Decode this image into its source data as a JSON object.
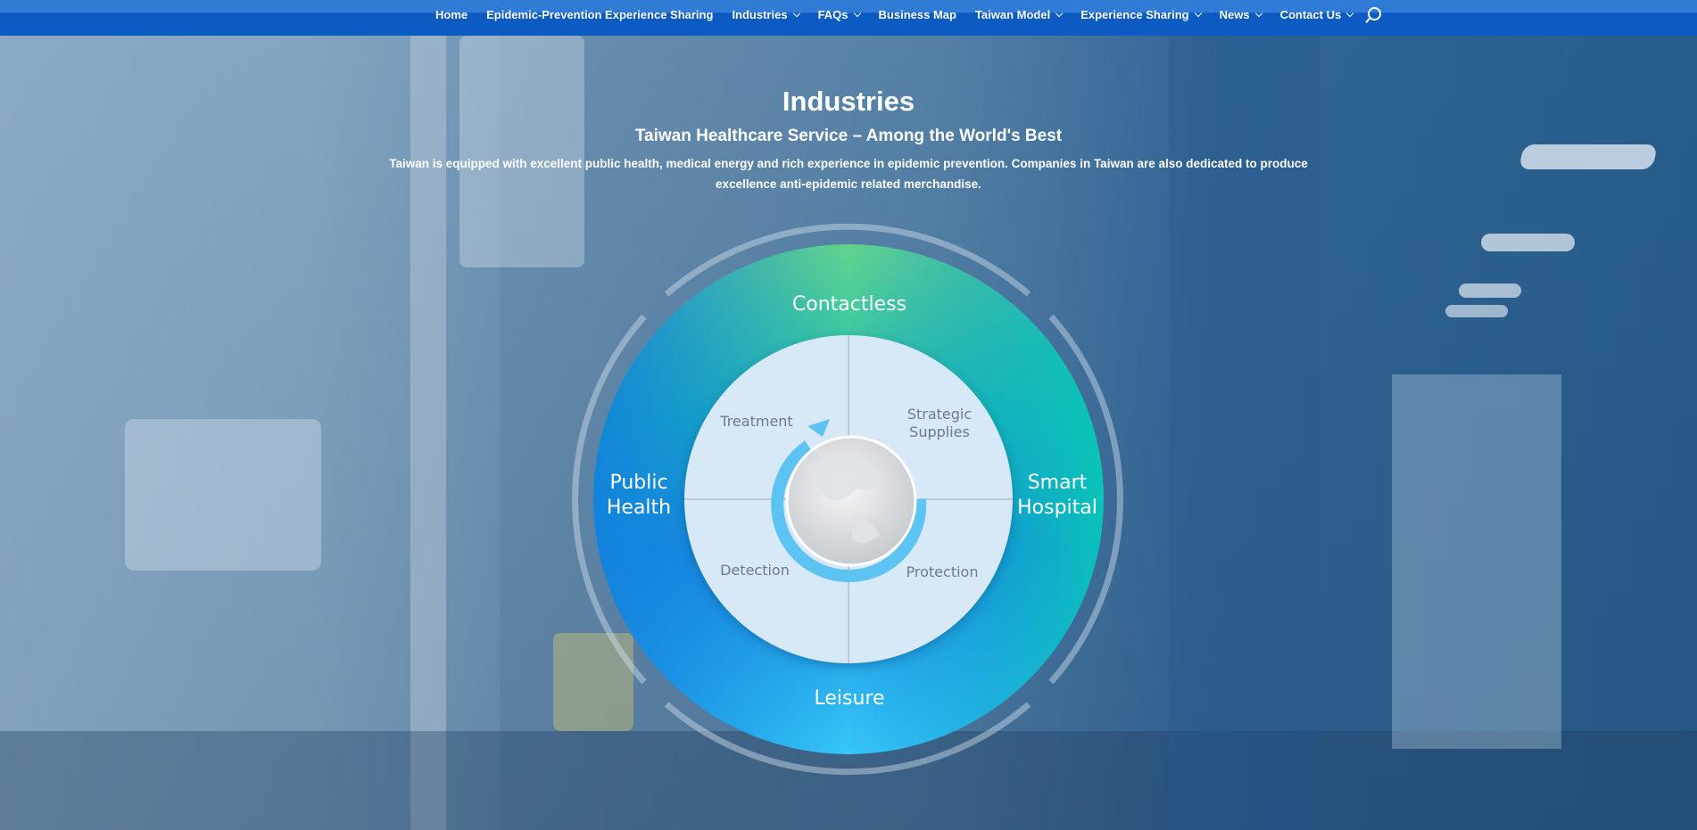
{
  "nav": {
    "items": [
      {
        "label": "Home",
        "dropdown": false
      },
      {
        "label": "Epidemic-Prevention Experience Sharing",
        "dropdown": false
      },
      {
        "label": "Industries",
        "dropdown": true
      },
      {
        "label": "FAQs",
        "dropdown": true
      },
      {
        "label": "Business Map",
        "dropdown": false
      },
      {
        "label": "Taiwan Model",
        "dropdown": true
      },
      {
        "label": "Experience Sharing",
        "dropdown": true
      },
      {
        "label": "News",
        "dropdown": true
      },
      {
        "label": "Contact Us",
        "dropdown": true
      }
    ],
    "search_icon": "search-icon"
  },
  "hero": {
    "title": "Industries",
    "subtitle": "Taiwan Healthcare Service – Among the World's Best",
    "description_line1": "Taiwan is equipped with excellent public health, medical energy and rich experience in epidemic prevention. Companies in Taiwan are also dedicated to produce",
    "description_line2": "excellence anti-epidemic related merchandise."
  },
  "diagram": {
    "outer": {
      "top": "Contactless",
      "left_line1": "Public",
      "left_line2": "Health",
      "right_line1": "Smart",
      "right_line2": "Hospital",
      "bottom": "Leisure"
    },
    "inner": {
      "top_left": "Treatment",
      "top_right_line1": "Strategic",
      "top_right_line2": "Supplies",
      "bottom_left": "Detection",
      "bottom_right": "Protection"
    },
    "center_icon": "globe-icon",
    "colors": {
      "green": "#5fd18f",
      "teal": "#10c2b4",
      "blue": "#1b86e0",
      "sky": "#35c4f5",
      "inner": "#d6e9f7",
      "text_gray": "#6e7a86"
    }
  }
}
